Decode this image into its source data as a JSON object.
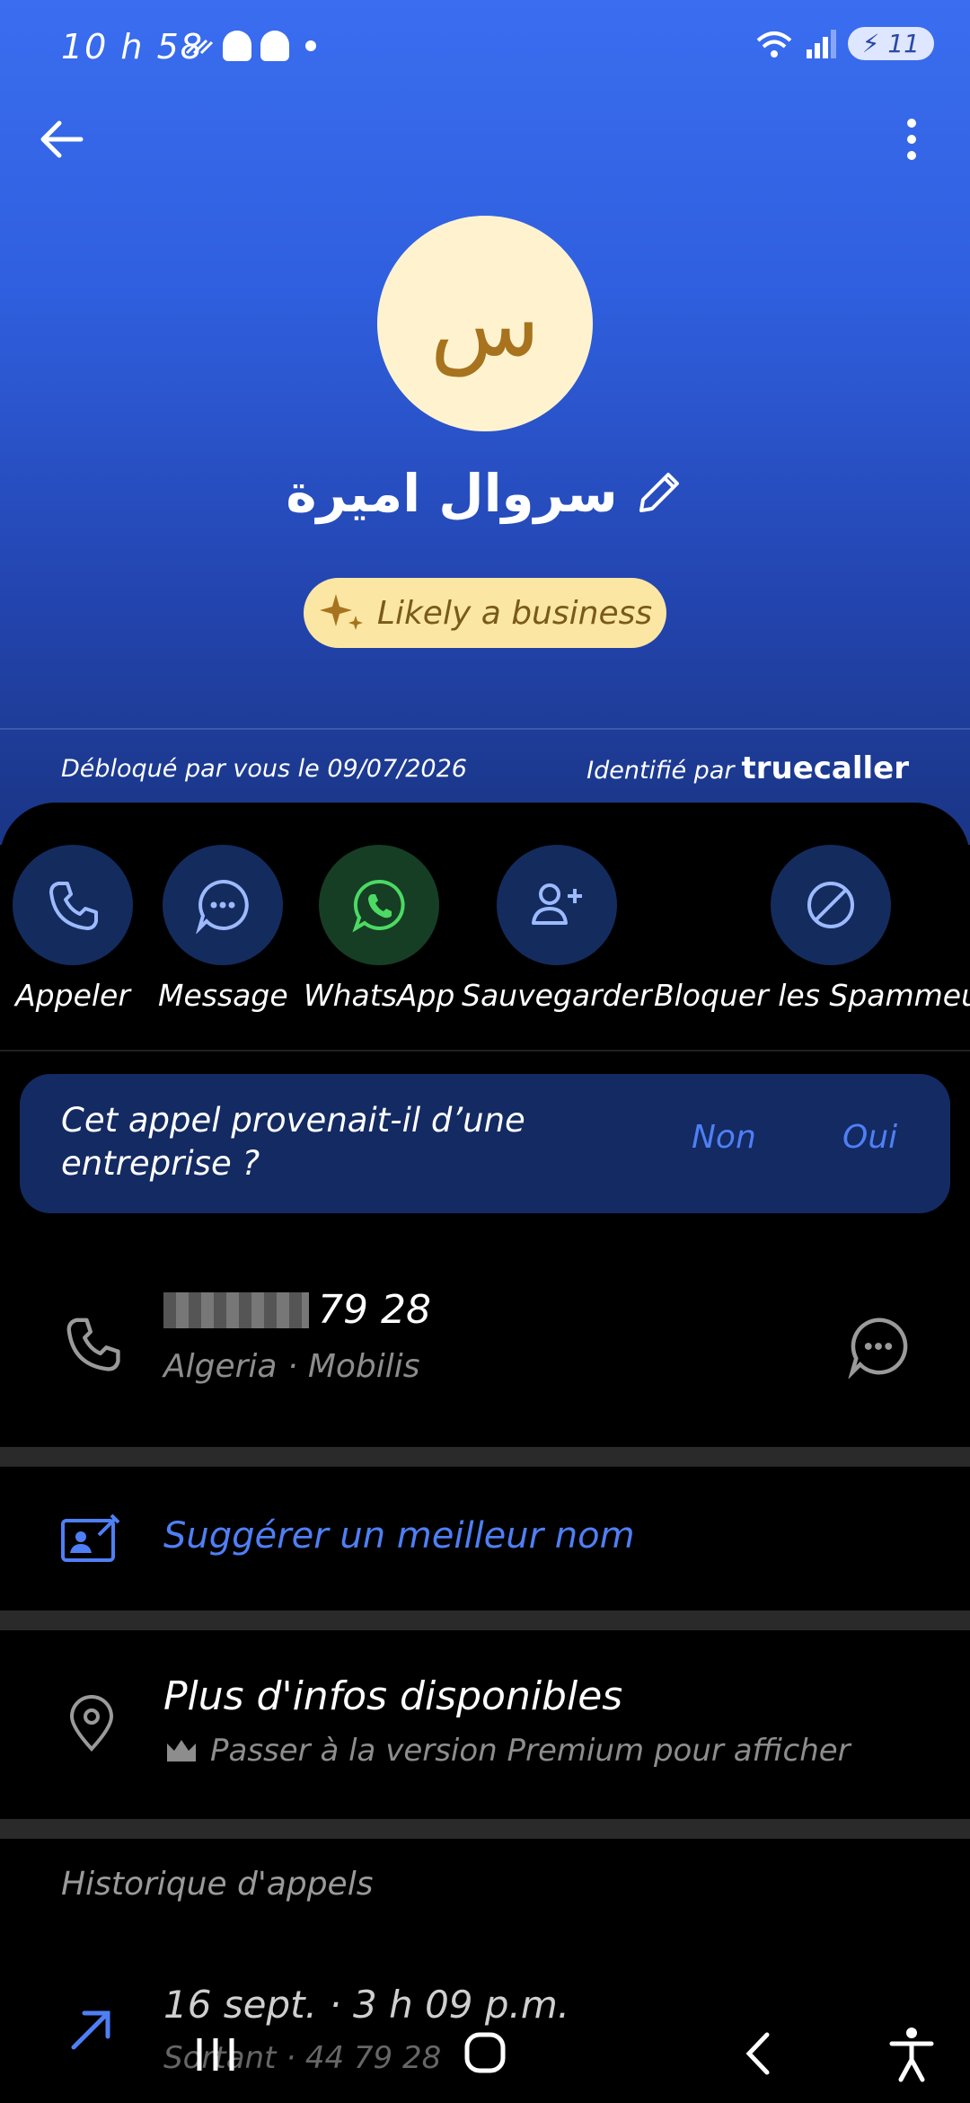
{
  "status": {
    "time": "10 h 58",
    "network": "6",
    "battery": "11"
  },
  "contact": {
    "initial": "س",
    "name": "سروال اميرة",
    "badge": "Likely a business"
  },
  "meta": {
    "unblocked": "Débloqué par vous le 09/07/2026",
    "identified": "Identifié par",
    "brand": "truecaller"
  },
  "actions": [
    {
      "label": "Appeler",
      "icon": "phone-icon"
    },
    {
      "label": "Message",
      "icon": "chat-bubble-icon"
    },
    {
      "label": "WhatsApp",
      "icon": "whatsapp-icon"
    },
    {
      "label": "Sauvegarder",
      "icon": "add-person-icon"
    },
    {
      "label": "Bloquer les Spammeurs",
      "icon": "block-icon"
    }
  ],
  "question": {
    "text": "Cet appel provenait-il d’une entreprise ?",
    "no": "Non",
    "yes": "Oui"
  },
  "number": {
    "visible_digits": "79 28",
    "carrier": "Algeria · Mobilis"
  },
  "suggest": {
    "label": "Suggérer un meilleur nom"
  },
  "more_info": {
    "title": "Plus d'infos disponibles",
    "subtitle": "Passer à la version Premium pour afficher"
  },
  "history": {
    "title": "Historique d'appels",
    "entry_date": "16 sept. · 3 h 09 p.m.",
    "entry_sub": "Sortant · 44 79 28"
  },
  "colors": {
    "accent": "#4f7ff5",
    "badge_bg": "#fbe7a3",
    "action_bg": "#142b5e"
  }
}
